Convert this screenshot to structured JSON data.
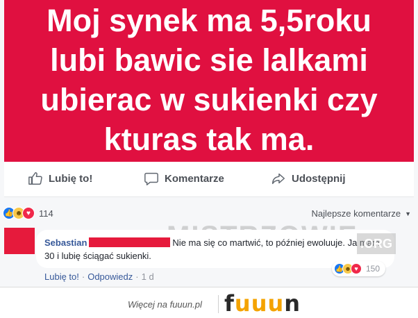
{
  "post": {
    "image_text": [
      "Moj synek ma 5,5roku",
      "lubi bawic sie lalkami",
      "ubierac w sukienki czy",
      "kturas tak ma."
    ],
    "colors": {
      "banner": "#e01040",
      "link": "#365899"
    }
  },
  "actions": {
    "like": "Lubię to!",
    "comment": "Komentarze",
    "share": "Udostępnij"
  },
  "summary": {
    "reactions": [
      "like-icon",
      "haha-icon",
      "love-icon"
    ],
    "reaction_count": "114",
    "sort_label": "Najlepsze komentarze"
  },
  "comment": {
    "author": "Sebastian",
    "text": "Nie ma się co martwić, to później ewoluuje. Ja mam 30 i lubię ściągać sukienki.",
    "reaction_count": "150",
    "like_label": "Lubię to!",
    "reply_label": "Odpowiedz",
    "time": "1 d"
  },
  "watermark": {
    "text": "MISTRZOWIE",
    "org": ".ORG"
  },
  "footer": {
    "text": "Więcej na fuuun.pl",
    "logo": [
      "f",
      "u",
      "u",
      "u",
      "n"
    ]
  }
}
